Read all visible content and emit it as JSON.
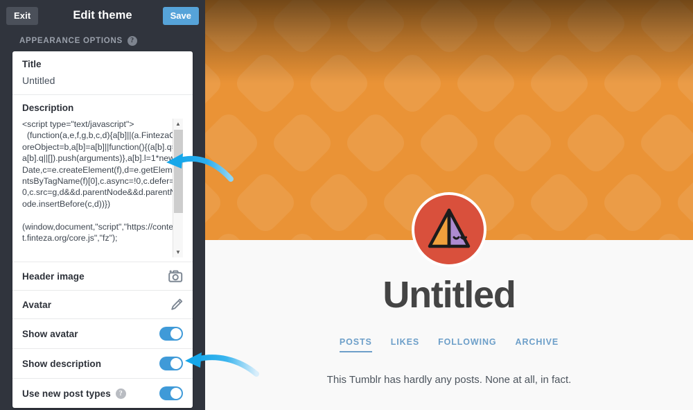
{
  "sidebar": {
    "exit_label": "Exit",
    "title": "Edit theme",
    "save_label": "Save",
    "section_label": "APPEARANCE OPTIONS",
    "help_glyph": "?",
    "fields": {
      "title": {
        "label": "Title",
        "value": "Untitled"
      },
      "description": {
        "label": "Description",
        "value": "<script type=\"text/javascript\">\n  (function(a,e,f,g,b,c,d){a[b]||(a.FintezaCoreObject=b,a[b]=a[b]||function(){(a[b].q=a[b].q||[]).push(arguments)},a[b].l=1*new Date,c=e.createElement(f),d=e.getElementsByTagName(f)[0],c.async=!0,c.defer=!0,c.src=g,d&&d.parentNode&&d.parentNode.insertBefore(c,d))})\n\n(window,document,\"script\",\"https://content.finteza.org/core.js\",\"fz\");"
      }
    },
    "rows": [
      {
        "label": "Header image",
        "control": "camera-add-icon"
      },
      {
        "label": "Avatar",
        "control": "pencil-icon"
      },
      {
        "label": "Show avatar",
        "control": "toggle",
        "state": "on"
      },
      {
        "label": "Show description",
        "control": "toggle",
        "state": "on"
      },
      {
        "label": "Use new post types",
        "control": "toggle",
        "state": "on",
        "has_help": true
      }
    ]
  },
  "preview": {
    "blog_title": "Untitled",
    "nav": [
      {
        "label": "POSTS",
        "active": true
      },
      {
        "label": "LIKES",
        "active": false
      },
      {
        "label": "FOLLOWING",
        "active": false
      },
      {
        "label": "ARCHIVE",
        "active": false
      }
    ],
    "empty_message": "This Tumblr has hardly any posts. None at all, in fact.",
    "avatar_alt": "pyramid-avatar"
  },
  "colors": {
    "sidebar_bg": "#30343d",
    "save_button": "#56a3d9",
    "toggle_on": "#3f9ad8",
    "header_orange": "#ea9336",
    "avatar_circle": "#d9503c",
    "nav_link": "#6d9fc9",
    "annotation_arrow": "#22a5e8"
  }
}
